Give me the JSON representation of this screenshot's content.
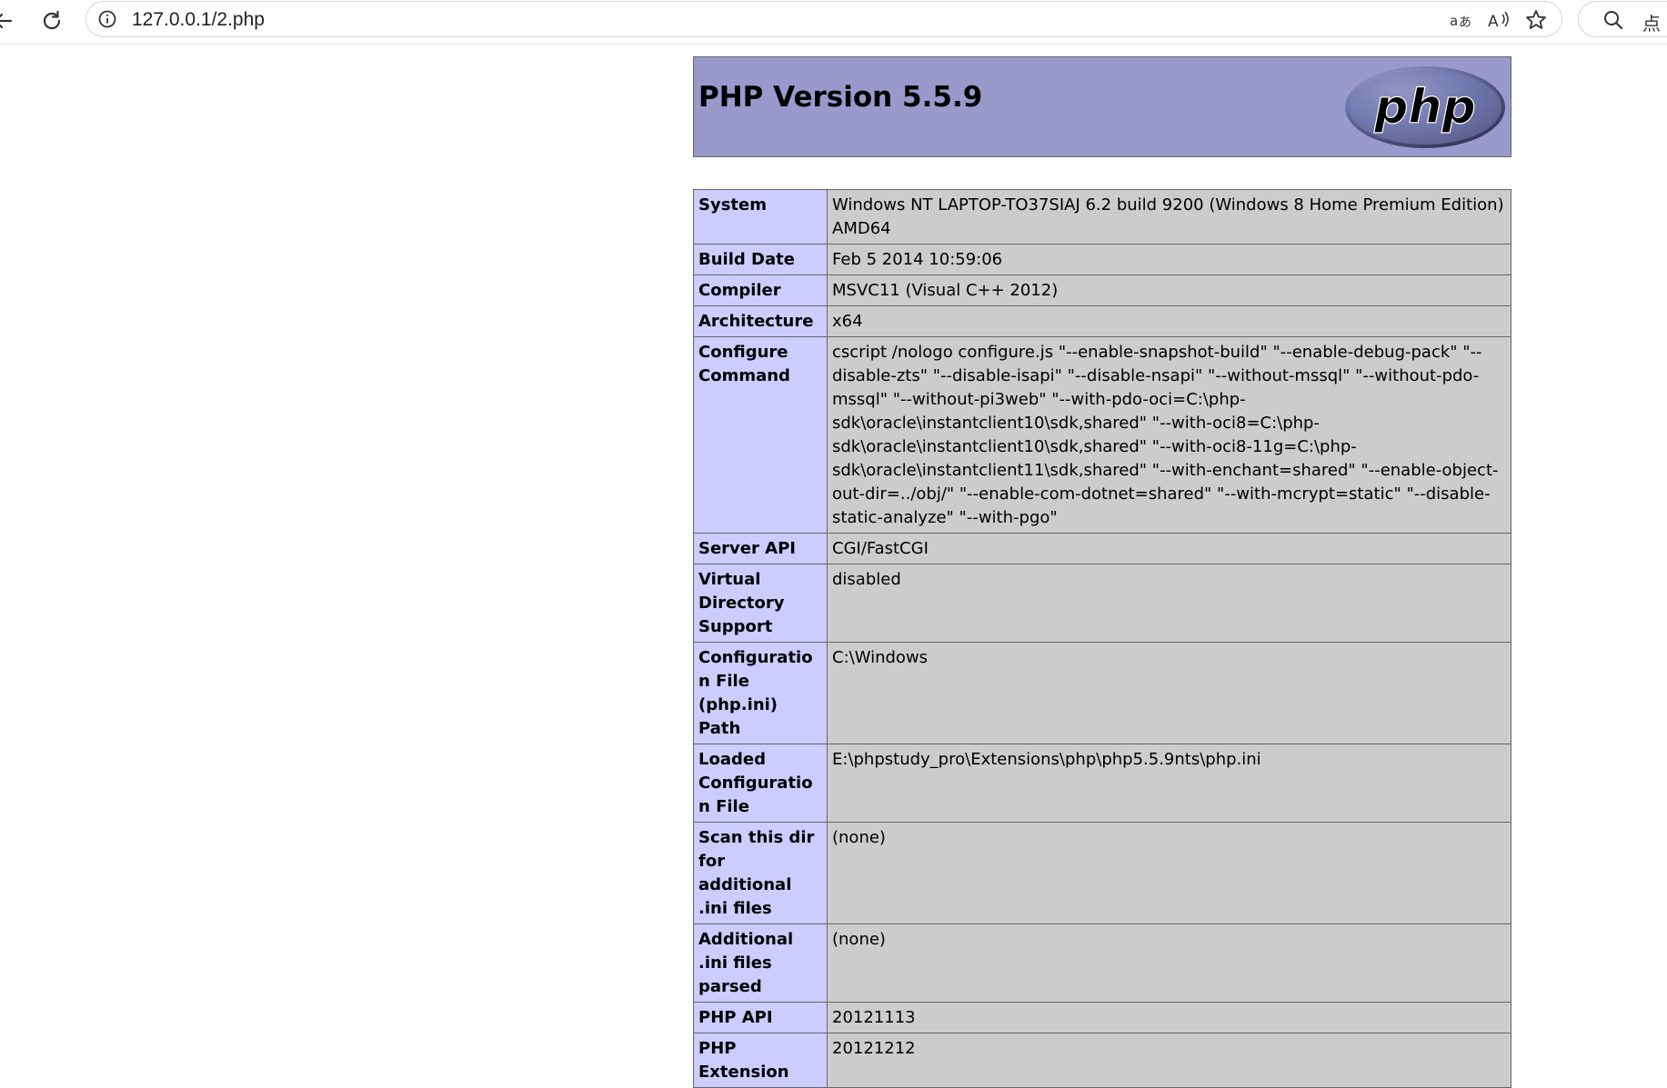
{
  "browser": {
    "url": "127.0.0.1/2.php",
    "side_text": "点",
    "icons": [
      "back-icon",
      "reload-icon",
      "info-icon",
      "translate-icon",
      "read-aloud-icon",
      "favorite-star-icon",
      "search-icon"
    ]
  },
  "php": {
    "title": "PHP Version 5.5.9",
    "logo_text": "php",
    "rows": [
      {
        "key": "System",
        "value": "Windows NT LAPTOP-TO37SIAJ 6.2 build 9200 (Windows 8 Home Premium Edition) AMD64"
      },
      {
        "key": "Build Date",
        "value": "Feb 5 2014 10:59:06"
      },
      {
        "key": "Compiler",
        "value": "MSVC11 (Visual C++ 2012)"
      },
      {
        "key": "Architecture",
        "value": "x64"
      },
      {
        "key": "Configure Command",
        "value": "cscript /nologo configure.js \"--enable-snapshot-build\" \"--enable-debug-pack\" \"--disable-zts\" \"--disable-isapi\" \"--disable-nsapi\" \"--without-mssql\" \"--without-pdo-mssql\" \"--without-pi3web\" \"--with-pdo-oci=C:\\php-sdk\\oracle\\instantclient10\\sdk,shared\" \"--with-oci8=C:\\php-sdk\\oracle\\instantclient10\\sdk,shared\" \"--with-oci8-11g=C:\\php-sdk\\oracle\\instantclient11\\sdk,shared\" \"--with-enchant=shared\" \"--enable-object-out-dir=../obj/\" \"--enable-com-dotnet=shared\" \"--with-mcrypt=static\" \"--disable-static-analyze\" \"--with-pgo\""
      },
      {
        "key": "Server API",
        "value": "CGI/FastCGI"
      },
      {
        "key": "Virtual Directory Support",
        "value": "disabled"
      },
      {
        "key": "Configuration File (php.ini) Path",
        "value": "C:\\Windows"
      },
      {
        "key": "Loaded Configuration File",
        "value": "E:\\phpstudy_pro\\Extensions\\php\\php5.5.9nts\\php.ini"
      },
      {
        "key": "Scan this dir for additional .ini files",
        "value": "(none)"
      },
      {
        "key": "Additional .ini files parsed",
        "value": "(none)"
      },
      {
        "key": "PHP API",
        "value": "20121113"
      },
      {
        "key": "PHP Extension",
        "value": "20121212"
      }
    ]
  },
  "colors": {
    "header_bg": "#9999cc",
    "key_bg": "#ccccff",
    "value_bg": "#cccccc",
    "border": "#666666"
  }
}
